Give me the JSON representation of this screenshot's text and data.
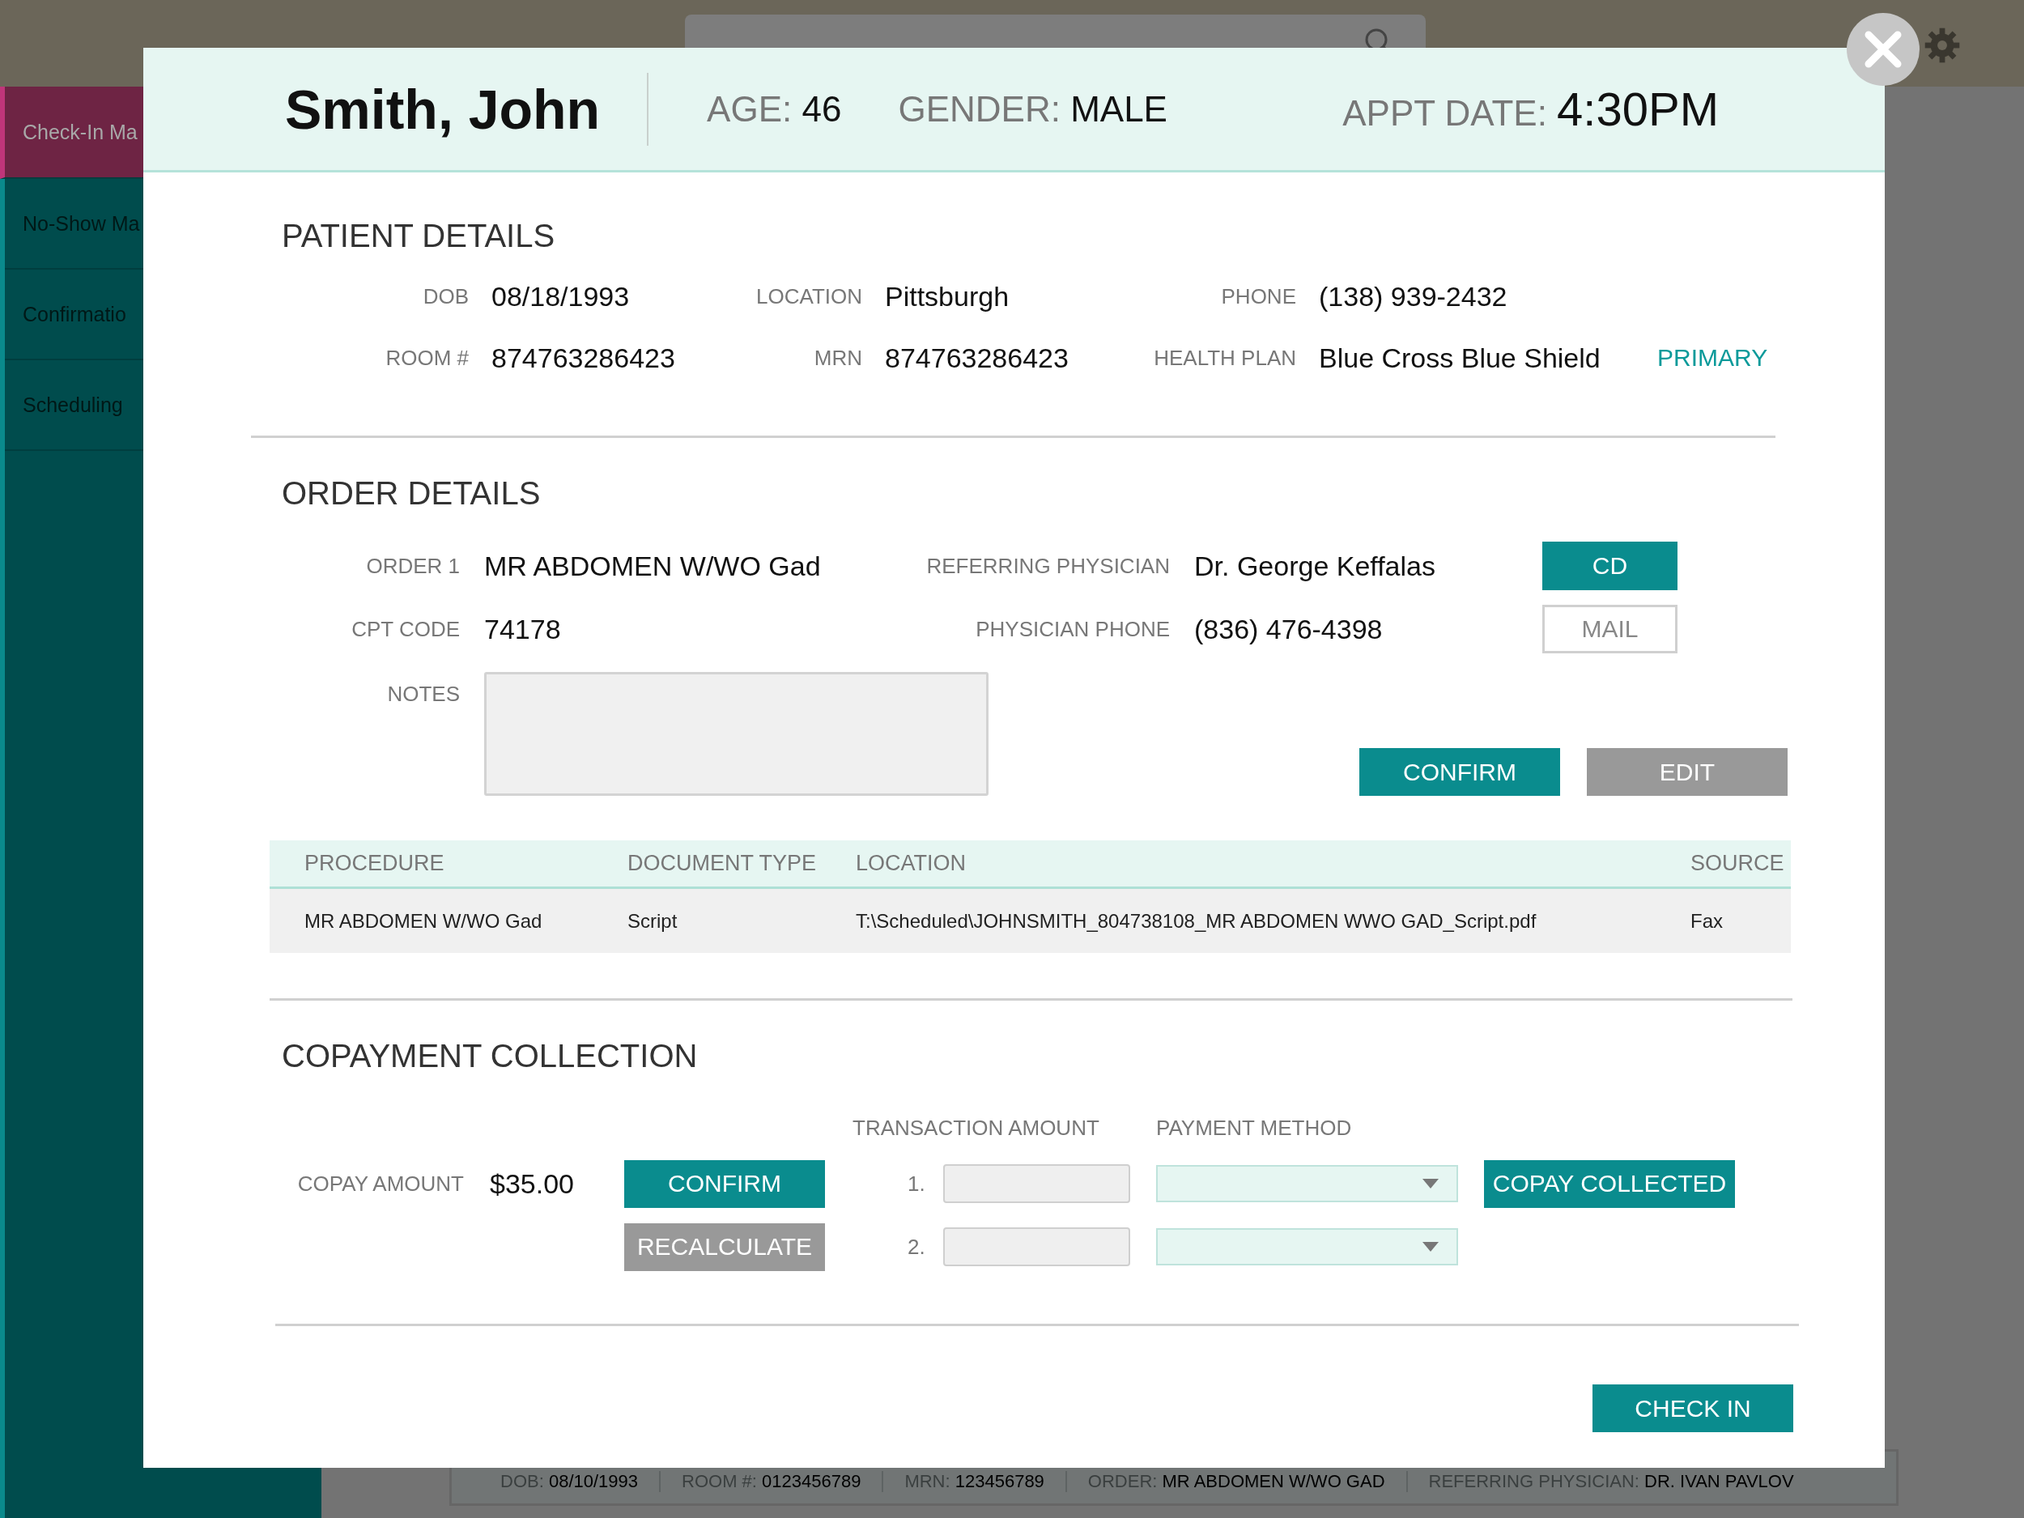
{
  "sidebar": {
    "items": [
      {
        "label": "Check-In Ma",
        "selected": true
      },
      {
        "label": "No-Show Ma",
        "selected": false
      },
      {
        "label": "Confirmatio",
        "selected": false
      },
      {
        "label": "Scheduling",
        "selected": false
      }
    ]
  },
  "background_card": {
    "fields": [
      {
        "label": "DOB:",
        "value": "08/10/1993"
      },
      {
        "label": "ROOM #:",
        "value": "0123456789"
      },
      {
        "label": "MRN:",
        "value": "123456789"
      },
      {
        "label": "ORDER:",
        "value": "MR ABDOMEN W/WO GAD"
      },
      {
        "label": "REFERRING PHYSICIAN:",
        "value": "DR. IVAN PAVLOV"
      }
    ]
  },
  "modal": {
    "header": {
      "name": "Smith, John",
      "fields": [
        {
          "label": "AGE:",
          "value": "46"
        },
        {
          "label": "GENDER:",
          "value": "MALE"
        }
      ],
      "appt": {
        "label": "APPT DATE:",
        "value": "4:30PM"
      }
    },
    "patient_details": {
      "title": "PATIENT DETAILS",
      "fields": [
        {
          "label": "DOB",
          "value": "08/18/1993"
        },
        {
          "label": "LOCATION",
          "value": "Pittsburgh"
        },
        {
          "label": "PHONE",
          "value": "(138) 939-2432"
        },
        {
          "label": "ROOM #",
          "value": "874763286423"
        },
        {
          "label": "MRN",
          "value": "874763286423"
        },
        {
          "label": "HEALTH PLAN",
          "value": "Blue Cross Blue Shield",
          "tag": "PRIMARY"
        }
      ]
    },
    "order_details": {
      "title": "ORDER DETAILS",
      "rows": [
        {
          "label": "ORDER 1",
          "value": "MR ABDOMEN W/WO Gad",
          "label2": "REFERRING PHYSICIAN",
          "value2": "Dr. George Keffalas",
          "button": {
            "label": "CD",
            "kind": "primary"
          }
        },
        {
          "label": "CPT CODE",
          "value": "74178",
          "label2": "PHYSICIAN PHONE",
          "value2": "(836) 476-4398",
          "button": {
            "label": "MAIL",
            "kind": "outline"
          }
        }
      ],
      "notes_label": "NOTES",
      "buttons": [
        {
          "label": "CONFIRM",
          "kind": "primary"
        },
        {
          "label": "EDIT",
          "kind": "secondary"
        }
      ]
    },
    "documents": {
      "columns": [
        "PROCEDURE",
        "DOCUMENT TYPE",
        "LOCATION",
        "SOURCE"
      ],
      "rows": [
        [
          "MR ABDOMEN W/WO Gad",
          "Script",
          "T:\\Scheduled\\JOHNSMITH_804738108_MR ABDOMEN WWO GAD_Script.pdf",
          "Fax"
        ]
      ]
    },
    "copayment": {
      "title": "COPAYMENT COLLECTION",
      "amount_label": "COPAY AMOUNT",
      "amount": "$35.00",
      "buttons": [
        {
          "label": "CONFIRM",
          "kind": "primary"
        },
        {
          "label": "RECALCULATE",
          "kind": "secondary"
        }
      ],
      "transaction_header": "TRANSACTION AMOUNT",
      "method_header": "PAYMENT METHOD",
      "lines": [
        {
          "number": "1."
        },
        {
          "number": "2."
        }
      ],
      "collected_button": {
        "label": "COPAY COLLECTED",
        "kind": "primary"
      }
    },
    "footer_button": {
      "label": "CHECK IN",
      "kind": "primary"
    }
  }
}
